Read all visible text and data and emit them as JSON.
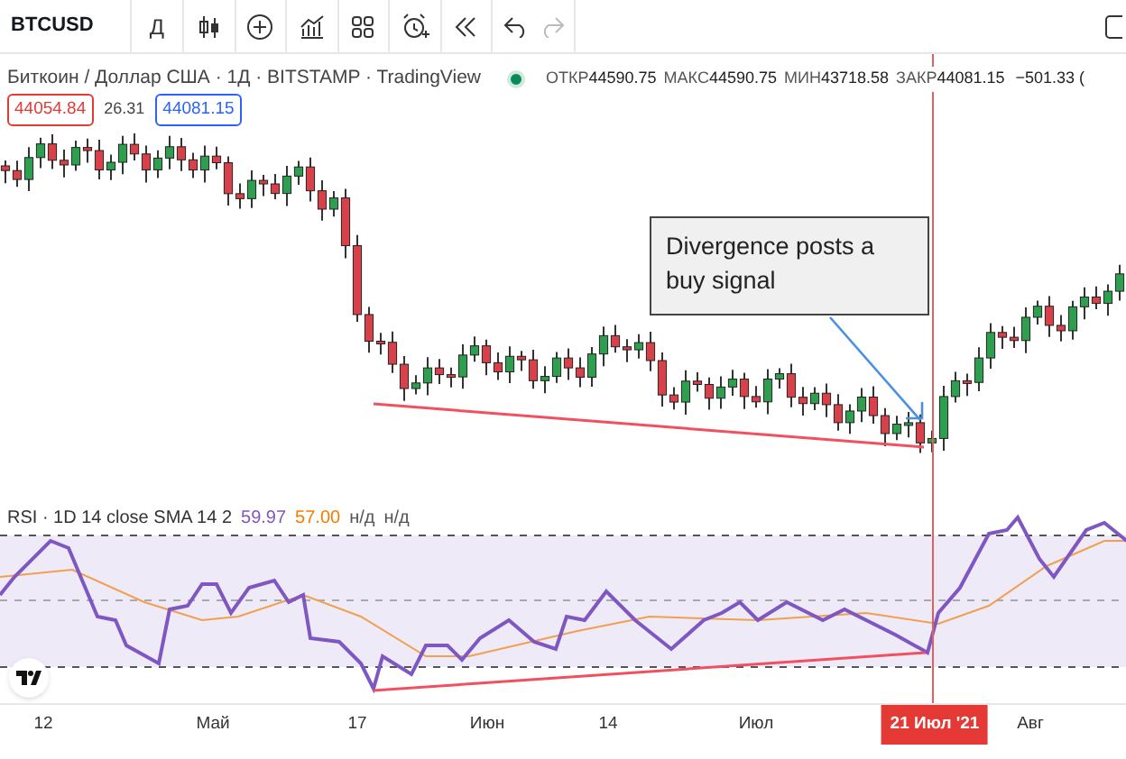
{
  "toolbar": {
    "symbol": "BTCUSD",
    "interval": "Д"
  },
  "header": {
    "title": "Биткоин / Доллар США · 1Д · BITSTAMP · TradingView",
    "ohlc": [
      {
        "label": "ОТКР",
        "value": "44590.75"
      },
      {
        "label": "МАКС",
        "value": "44590.75"
      },
      {
        "label": "МИН",
        "value": "43718.58"
      },
      {
        "label": "ЗАКР",
        "value": "44081.15"
      }
    ],
    "change": "−501.33 ("
  },
  "badges": [
    {
      "text": "44054.84",
      "color": "#e53935"
    },
    {
      "text": "26.31"
    },
    {
      "text": "44081.15",
      "color": "#2962ff"
    }
  ],
  "annotation": {
    "text": "Divergence posts a buy signal"
  },
  "rsi": {
    "title": "RSI · 1D 14 close SMA 14 2",
    "values": [
      {
        "text": "59.97",
        "color": "#7e57c2"
      },
      {
        "text": "57.00",
        "color": "#f57c00"
      },
      {
        "text": "н/д",
        "color": "#555555"
      },
      {
        "text": "н/д",
        "color": "#555555"
      }
    ]
  },
  "x_axis": [
    {
      "label": "12",
      "selected": false
    },
    {
      "label": "Май",
      "selected": false
    },
    {
      "label": "17",
      "selected": false
    },
    {
      "label": "Июн",
      "selected": false
    },
    {
      "label": "14",
      "selected": false
    },
    {
      "label": "Июл",
      "selected": false
    },
    {
      "label": "21 Июл '21",
      "selected": true
    },
    {
      "label": "Авг",
      "selected": false
    }
  ]
}
